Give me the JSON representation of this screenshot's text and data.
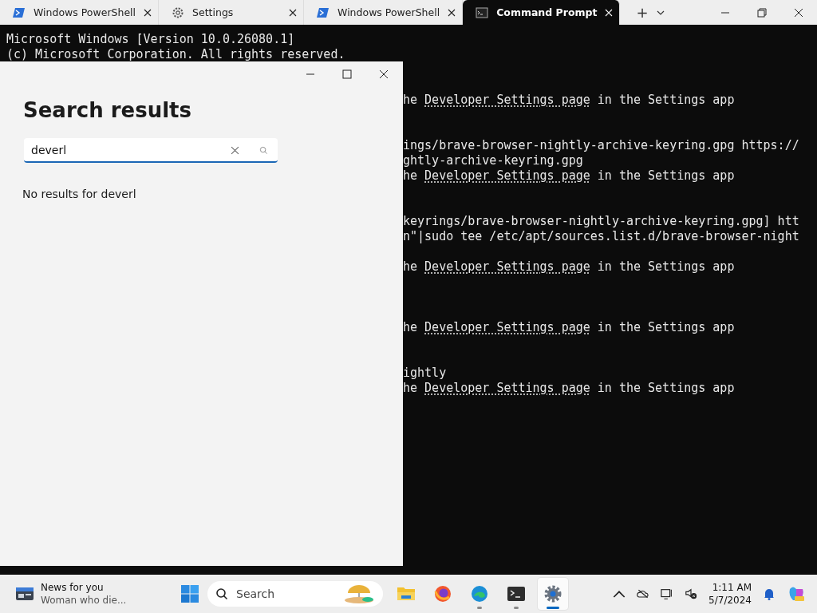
{
  "tabs": [
    {
      "label": "Windows PowerShell",
      "kind": "powershell",
      "selected": false
    },
    {
      "label": "Settings",
      "kind": "settings",
      "selected": false
    },
    {
      "label": "Windows PowerShell",
      "kind": "powershell",
      "selected": false
    },
    {
      "label": "Command Prompt",
      "kind": "cmd",
      "selected": true
    }
  ],
  "new_tab": "+",
  "terminal_lines": [
    {
      "kind": "full",
      "text": "Microsoft Windows [Version 10.0.26080.1]"
    },
    {
      "kind": "full",
      "text": "(c) Microsoft Corporation. All rights reserved."
    },
    {
      "kind": "link",
      "prefix": "he ",
      "link": "Developer Settings page",
      "suffix": " in the Settings app"
    },
    {
      "kind": "tail",
      "text": "ings/brave-browser-nightly-archive-keyring.gpg https://"
    },
    {
      "kind": "tail",
      "text": "ghtly-archive-keyring.gpg"
    },
    {
      "kind": "link",
      "prefix": "he ",
      "link": "Developer Settings page",
      "suffix": " in the Settings app"
    },
    {
      "kind": "tail",
      "text": "keyrings/brave-browser-nightly-archive-keyring.gpg] htt"
    },
    {
      "kind": "tail",
      "text": "n\"|sudo tee /etc/apt/sources.list.d/brave-browser-night"
    },
    {
      "kind": "link",
      "prefix": "he ",
      "link": "Developer Settings page",
      "suffix": " in the Settings app"
    },
    {
      "kind": "link",
      "prefix": "he ",
      "link": "Developer Settings page",
      "suffix": " in the Settings app"
    },
    {
      "kind": "tail",
      "text": "ightly"
    },
    {
      "kind": "link",
      "prefix": "he ",
      "link": "Developer Settings page",
      "suffix": " in the Settings app"
    }
  ],
  "settings": {
    "heading": "Search results",
    "search": {
      "value": "deverl"
    },
    "message": "No results for deverl"
  },
  "taskbar": {
    "news_title": "News for you",
    "news_text": "Woman who die...",
    "search_placeholder": "Search",
    "apps": [
      {
        "kind": "explorer",
        "running": false,
        "selected": false
      },
      {
        "kind": "firefox",
        "running": false,
        "selected": false
      },
      {
        "kind": "edge",
        "running": true,
        "selected": false
      },
      {
        "kind": "terminal",
        "running": true,
        "selected": false
      },
      {
        "kind": "settings",
        "running": true,
        "selected": true
      }
    ],
    "time": "1:11 AM",
    "date": "5/7/2024"
  }
}
